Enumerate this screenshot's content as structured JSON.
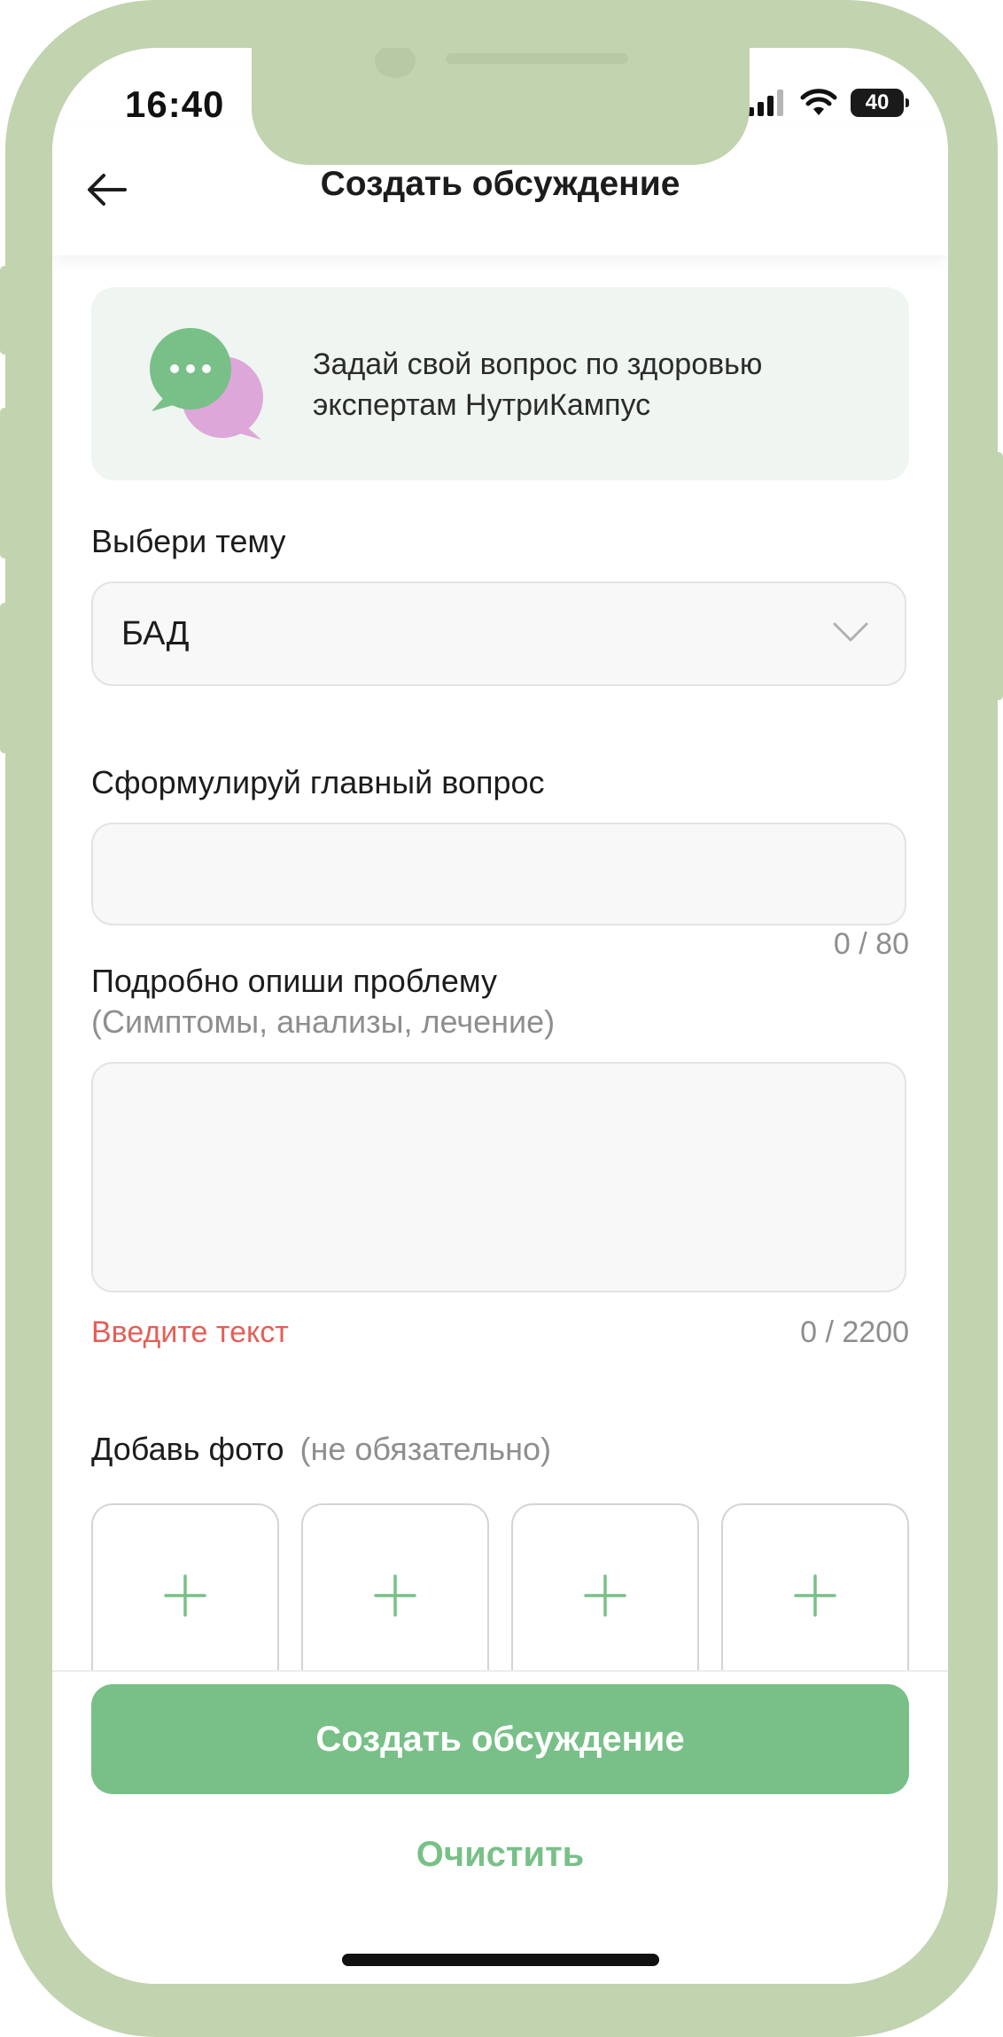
{
  "status_bar": {
    "time": "16:40",
    "battery": "40"
  },
  "header": {
    "title": "Создать обсуждение"
  },
  "info_card": {
    "text": "Задай свой вопрос по здоровью экспертам НутриКампус"
  },
  "topic": {
    "label": "Выбери тему",
    "selected": "БАД"
  },
  "question": {
    "label": "Сформулируй главный вопрос",
    "value": "",
    "counter": "0 / 80"
  },
  "details": {
    "label": "Подробно опиши проблему",
    "sublabel": "(Симптомы, анализы, лечение)",
    "value": "",
    "error": "Введите текст",
    "counter": "0 / 2200"
  },
  "photos": {
    "label": "Добавь фото",
    "optional": "(не обязательно)",
    "slots": 4
  },
  "actions": {
    "submit": "Создать обсуждение",
    "clear": "Очистить"
  },
  "colors": {
    "frame": "#c1d3af",
    "accent": "#78c087",
    "error": "#e35f58",
    "card": "#eff5f0"
  }
}
